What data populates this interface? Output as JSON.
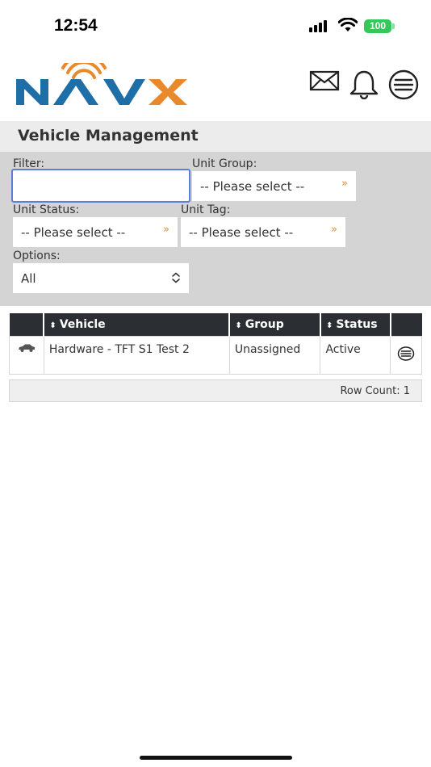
{
  "status_bar": {
    "time": "12:54",
    "battery": "100"
  },
  "header": {
    "logo_text": "NAVX",
    "icons": [
      "mail-icon",
      "bell-icon",
      "menu-icon"
    ]
  },
  "page": {
    "title": "Vehicle Management"
  },
  "filters": {
    "filter_label": "Filter:",
    "filter_value": "",
    "unit_group_label": "Unit Group:",
    "unit_group_value": "-- Please select --",
    "unit_status_label": "Unit Status:",
    "unit_status_value": "-- Please select --",
    "unit_tag_label": "Unit Tag:",
    "unit_tag_value": "-- Please select --",
    "options_label": "Options:",
    "options_value": "All",
    "chevron": "»"
  },
  "table": {
    "columns": [
      "Vehicle",
      "Group",
      "Status"
    ],
    "rows": [
      {
        "vehicle": "Hardware - TFT S1 Test 2",
        "group": "Unassigned",
        "status": "Active"
      }
    ],
    "row_count": "Row Count: 1"
  },
  "colors": {
    "accent_orange": "#e8892c",
    "logo_blue": "#1e6fa8",
    "header_dark": "#2b2f33",
    "focus_blue": "#5a7fd6"
  }
}
